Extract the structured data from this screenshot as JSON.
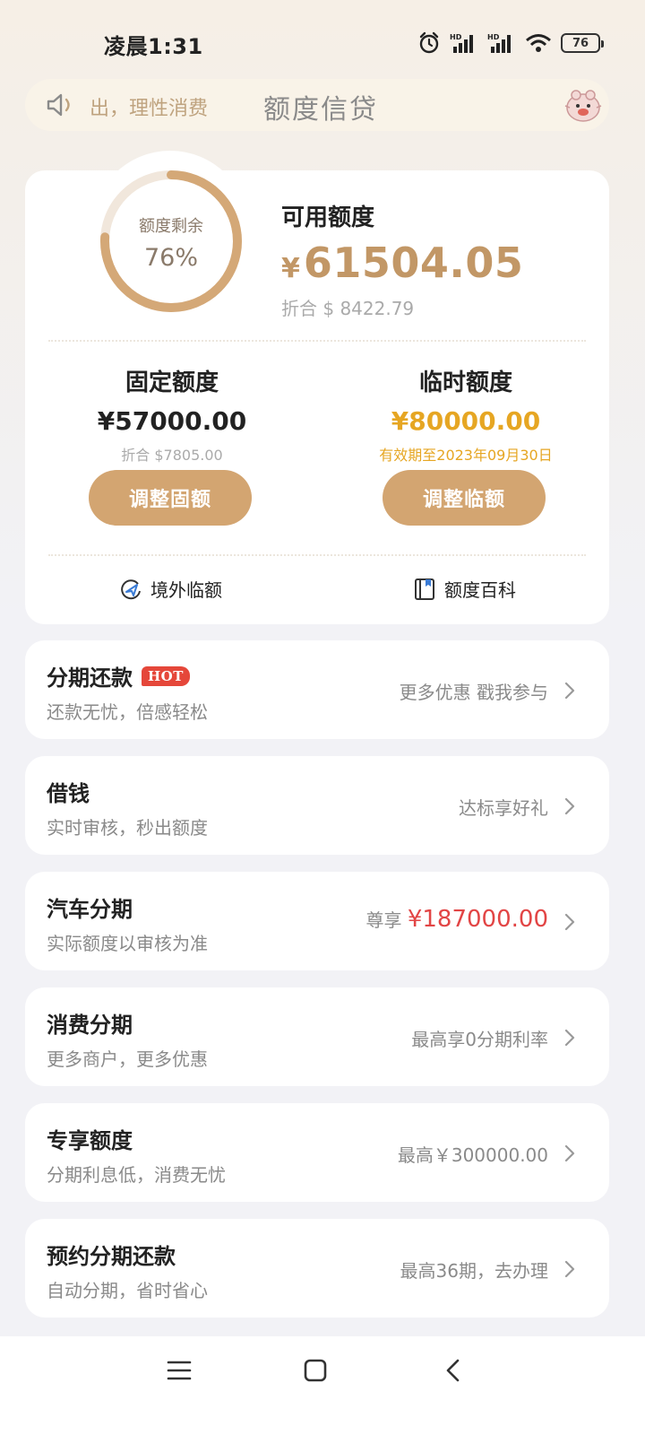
{
  "status_bar": {
    "time": "凌晨1:31",
    "battery": "76",
    "icons": [
      "alarm-icon",
      "signal-hd-icon",
      "signal-hd-icon",
      "wifi-icon",
      "battery-icon"
    ]
  },
  "header": {
    "marquee": "出，理性消费",
    "title": "额度信贷",
    "icons": [
      "speaker-icon",
      "mascot-icon"
    ]
  },
  "credit": {
    "ring_label": "额度剩余",
    "ring_percent": "76%",
    "ring_fraction": 0.76,
    "available_label": "可用额度",
    "available_currency": "¥",
    "available_amount": "61504.05",
    "available_usd": "折合 $ 8422.79",
    "fixed": {
      "title": "固定额度",
      "amount": "¥57000.00",
      "sub": "折合 $7805.00",
      "button": "调整固额"
    },
    "temporary": {
      "title": "临时额度",
      "amount": "¥80000.00",
      "sub": "有效期至2023年09月30日",
      "button": "调整临额"
    },
    "links": [
      {
        "label": "境外临额",
        "icon": "plane-globe-icon"
      },
      {
        "label": "额度百科",
        "icon": "book-icon"
      }
    ]
  },
  "services": [
    {
      "title": "分期还款",
      "badge": "HOT",
      "subtitle": "还款无忧，倍感轻松",
      "right": "更多优惠 戳我参与"
    },
    {
      "title": "借钱",
      "subtitle": "实时审核，秒出额度",
      "right": "达标享好礼"
    },
    {
      "title": "汽车分期",
      "subtitle": "实际额度以审核为准",
      "right_prefix": "尊享",
      "right_highlight": "¥187000.00"
    },
    {
      "title": "消费分期",
      "subtitle": "更多商户，更多优惠",
      "right": "最高享0分期利率"
    },
    {
      "title": "专享额度",
      "subtitle": "分期利息低，消费无忧",
      "right": "最高￥300000.00"
    },
    {
      "title": "预约分期还款",
      "subtitle": "自动分期，省时省心",
      "right": "最高36期，去办理"
    }
  ],
  "colors": {
    "accent_gold": "#c29766",
    "button_gold": "#d3a571",
    "temp_amount": "#e6a623",
    "highlight_red": "#e24545"
  },
  "nav": [
    "menu-icon",
    "home-icon",
    "back-icon"
  ]
}
